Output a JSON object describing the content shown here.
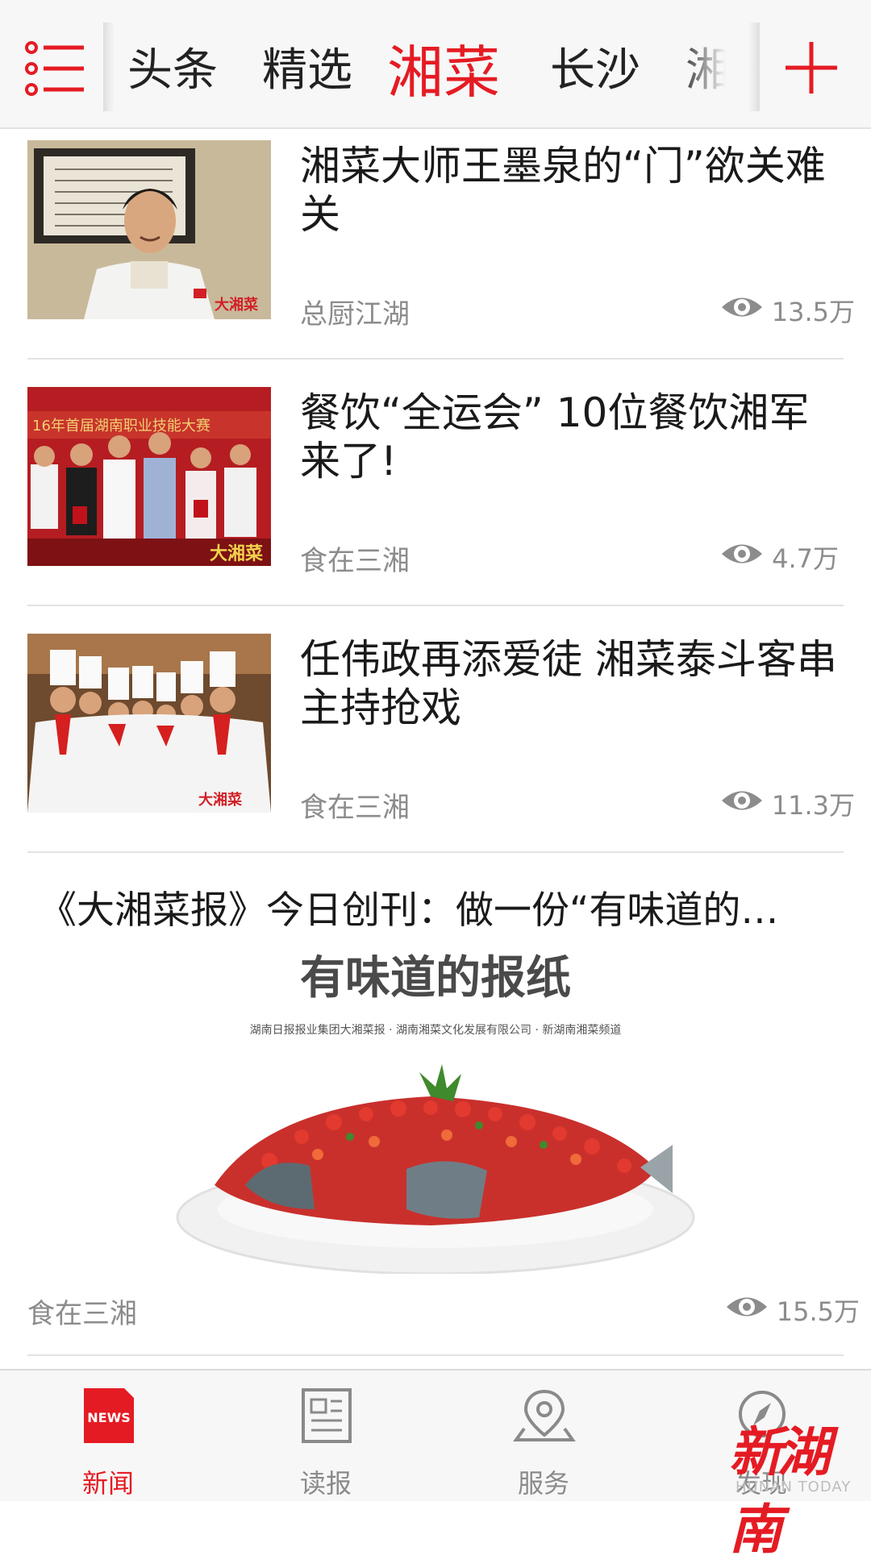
{
  "header": {
    "tabs": [
      {
        "label": "头条"
      },
      {
        "label": "精选"
      },
      {
        "label": "湘菜"
      },
      {
        "label": "长沙"
      },
      {
        "label": "湘"
      }
    ],
    "active_tab": "湘菜"
  },
  "articles": [
    {
      "title": "湘菜大师王墨泉的“门”欲关难关",
      "source": "总厨江湖",
      "views": "13.5万"
    },
    {
      "title": "餐饮“全运会” 10位餐饮湘军来了!",
      "source": "食在三湘",
      "views": "4.7万"
    },
    {
      "title": "任伟政再添爱徒 湘菜泰斗客串主持抢戏",
      "source": "食在三湘",
      "views": "11.3万"
    }
  ],
  "featured": {
    "title": "《大湘菜报》今日创刊：做一份“有味道的…",
    "image_headline": "有味道的报纸",
    "image_subline": "湖南日报报业集团大湘菜报 · 湖南湘菜文化发展有限公司 · 新湖南湘菜频道",
    "source": "食在三湘",
    "views": "15.5万"
  },
  "bottom_nav": [
    {
      "label": "新闻",
      "icon": "news-icon",
      "badge": "NEWS"
    },
    {
      "label": "读报",
      "icon": "newspaper-icon"
    },
    {
      "label": "服务",
      "icon": "location-pin-icon"
    },
    {
      "label": "发现",
      "icon": "compass-icon"
    }
  ],
  "watermark": {
    "text": "新湖南",
    "sub": "HUNAN TODAY"
  },
  "colors": {
    "accent": "#e51b23",
    "muted": "#8c8c8c",
    "bar_bg": "#f7f7f7"
  }
}
